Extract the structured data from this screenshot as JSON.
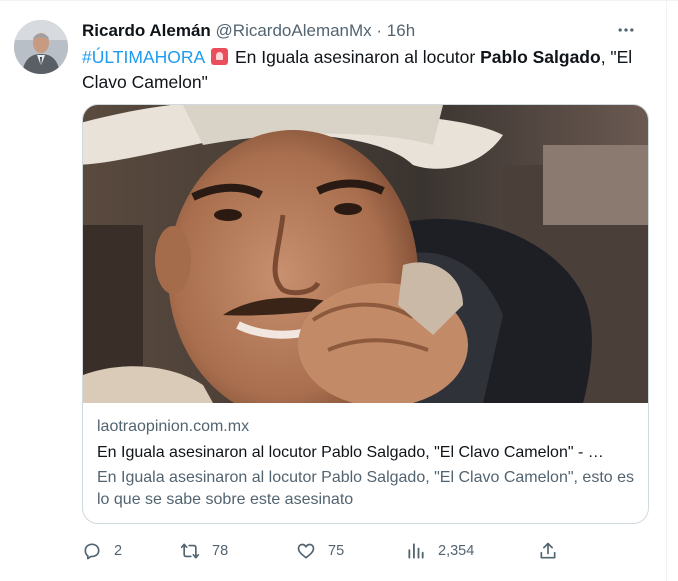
{
  "tweet": {
    "author_name": "Ricardo Alemán",
    "author_handle": "@RicardoAlemanMx",
    "separator": " · ",
    "time": "16h",
    "hashtag": "#ÚLTIMAHORA",
    "text_part1": " En Iguala asesinaron al locutor ",
    "text_bold": "Pablo Salgado",
    "text_part2": ", \"El Clavo Camelon\""
  },
  "card": {
    "domain": "laotraopinion.com.mx",
    "title": "En Iguala asesinaron al locutor Pablo Salgado, \"El Clavo Camelon\" - …",
    "description": "En Iguala asesinaron al locutor Pablo Salgado, \"El Clavo Camelon\", esto es lo que se sabe sobre este asesinato"
  },
  "actions": {
    "replies": "2",
    "retweets": "78",
    "likes": "75",
    "views": "2,354"
  },
  "icons": [
    "more-icon",
    "siren-icon",
    "reply-icon",
    "retweet-icon",
    "like-icon",
    "views-icon",
    "share-icon"
  ],
  "colors": {
    "accent": "#1d9bf0",
    "secondary_text": "#536471",
    "border": "#cfd9de"
  }
}
